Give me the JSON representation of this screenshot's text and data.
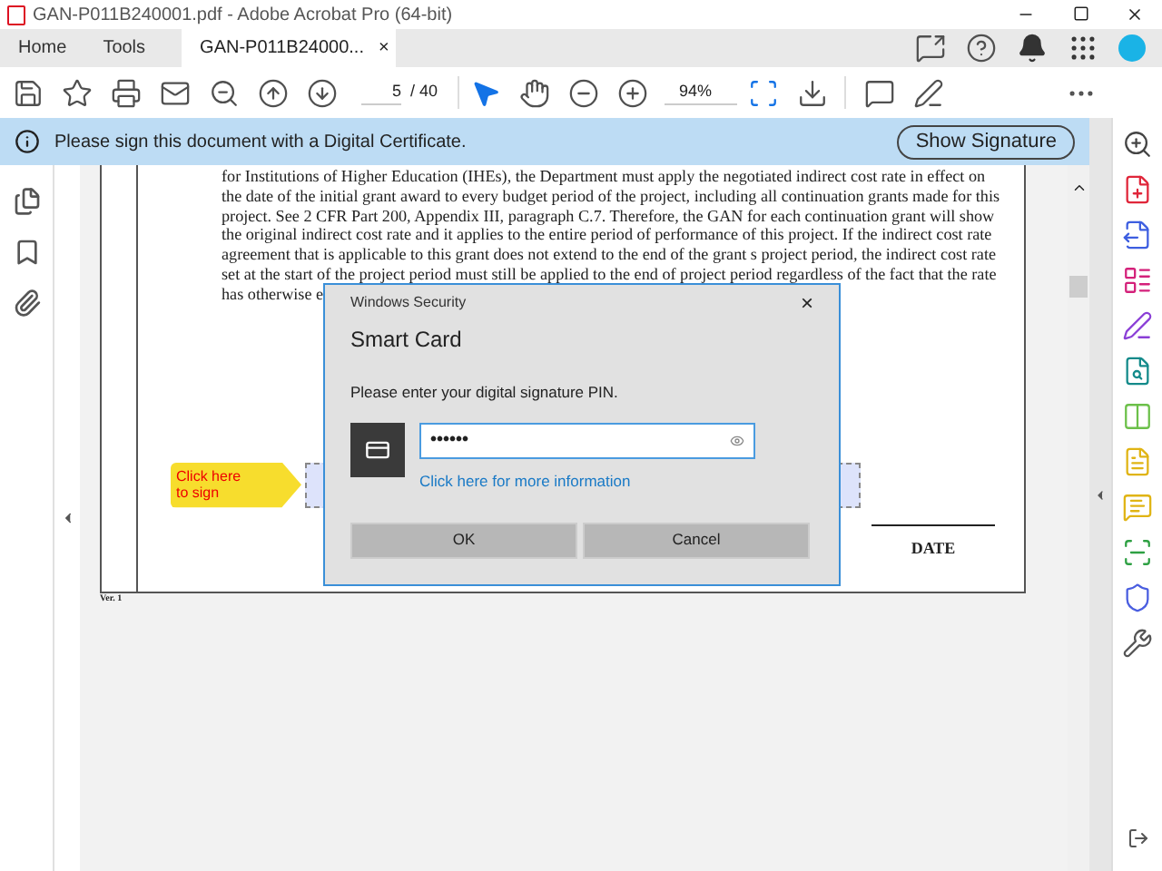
{
  "window": {
    "title": "GAN-P011B240001.pdf - Adobe Acrobat Pro (64-bit)"
  },
  "tabs": [
    {
      "label": "Home",
      "selected": false
    },
    {
      "label": "Tools",
      "selected": false
    },
    {
      "label": "GAN-P011B24000...",
      "selected": true,
      "close": "×"
    }
  ],
  "toolbar": {
    "page": "5",
    "page_total": "/ 40",
    "zoom": "94%"
  },
  "banner": {
    "message": "Please sign this document with a Digital Certificate.",
    "button": "Show Signature"
  },
  "document": {
    "lines": [
      "for Institutions of Higher Education (IHEs), the Department must apply the negotiated indirect cost rate in effect on",
      "the date of the initial grant award to every budget period of the project, including all continuation grants made for this",
      "project. See 2 CFR Part 200, Appendix III, paragraph C.7. Therefore, the GAN for each continuation grant will show",
      "the original indirect cost rate and it applies to the entire period of performance of this project. If the indirect cost rate",
      "agreement that is applicable to this grant does not extend to the end of the grant s project period, the indirect cost rate",
      "set at the start of the project period must still be applied to the end of project period regardless of the fact that the rate",
      "has otherwise e"
    ],
    "sign_callout": [
      "Click here",
      "to sign"
    ],
    "date_label": "DATE",
    "footer": "Ver. 1"
  },
  "dialog": {
    "caption": "Windows Security",
    "close": "×",
    "title": "Smart Card",
    "prompt": "Please enter your digital signature PIN.",
    "pin": "••••••",
    "link": "Click here for more information",
    "buttons": [
      "OK",
      "Cancel"
    ]
  }
}
